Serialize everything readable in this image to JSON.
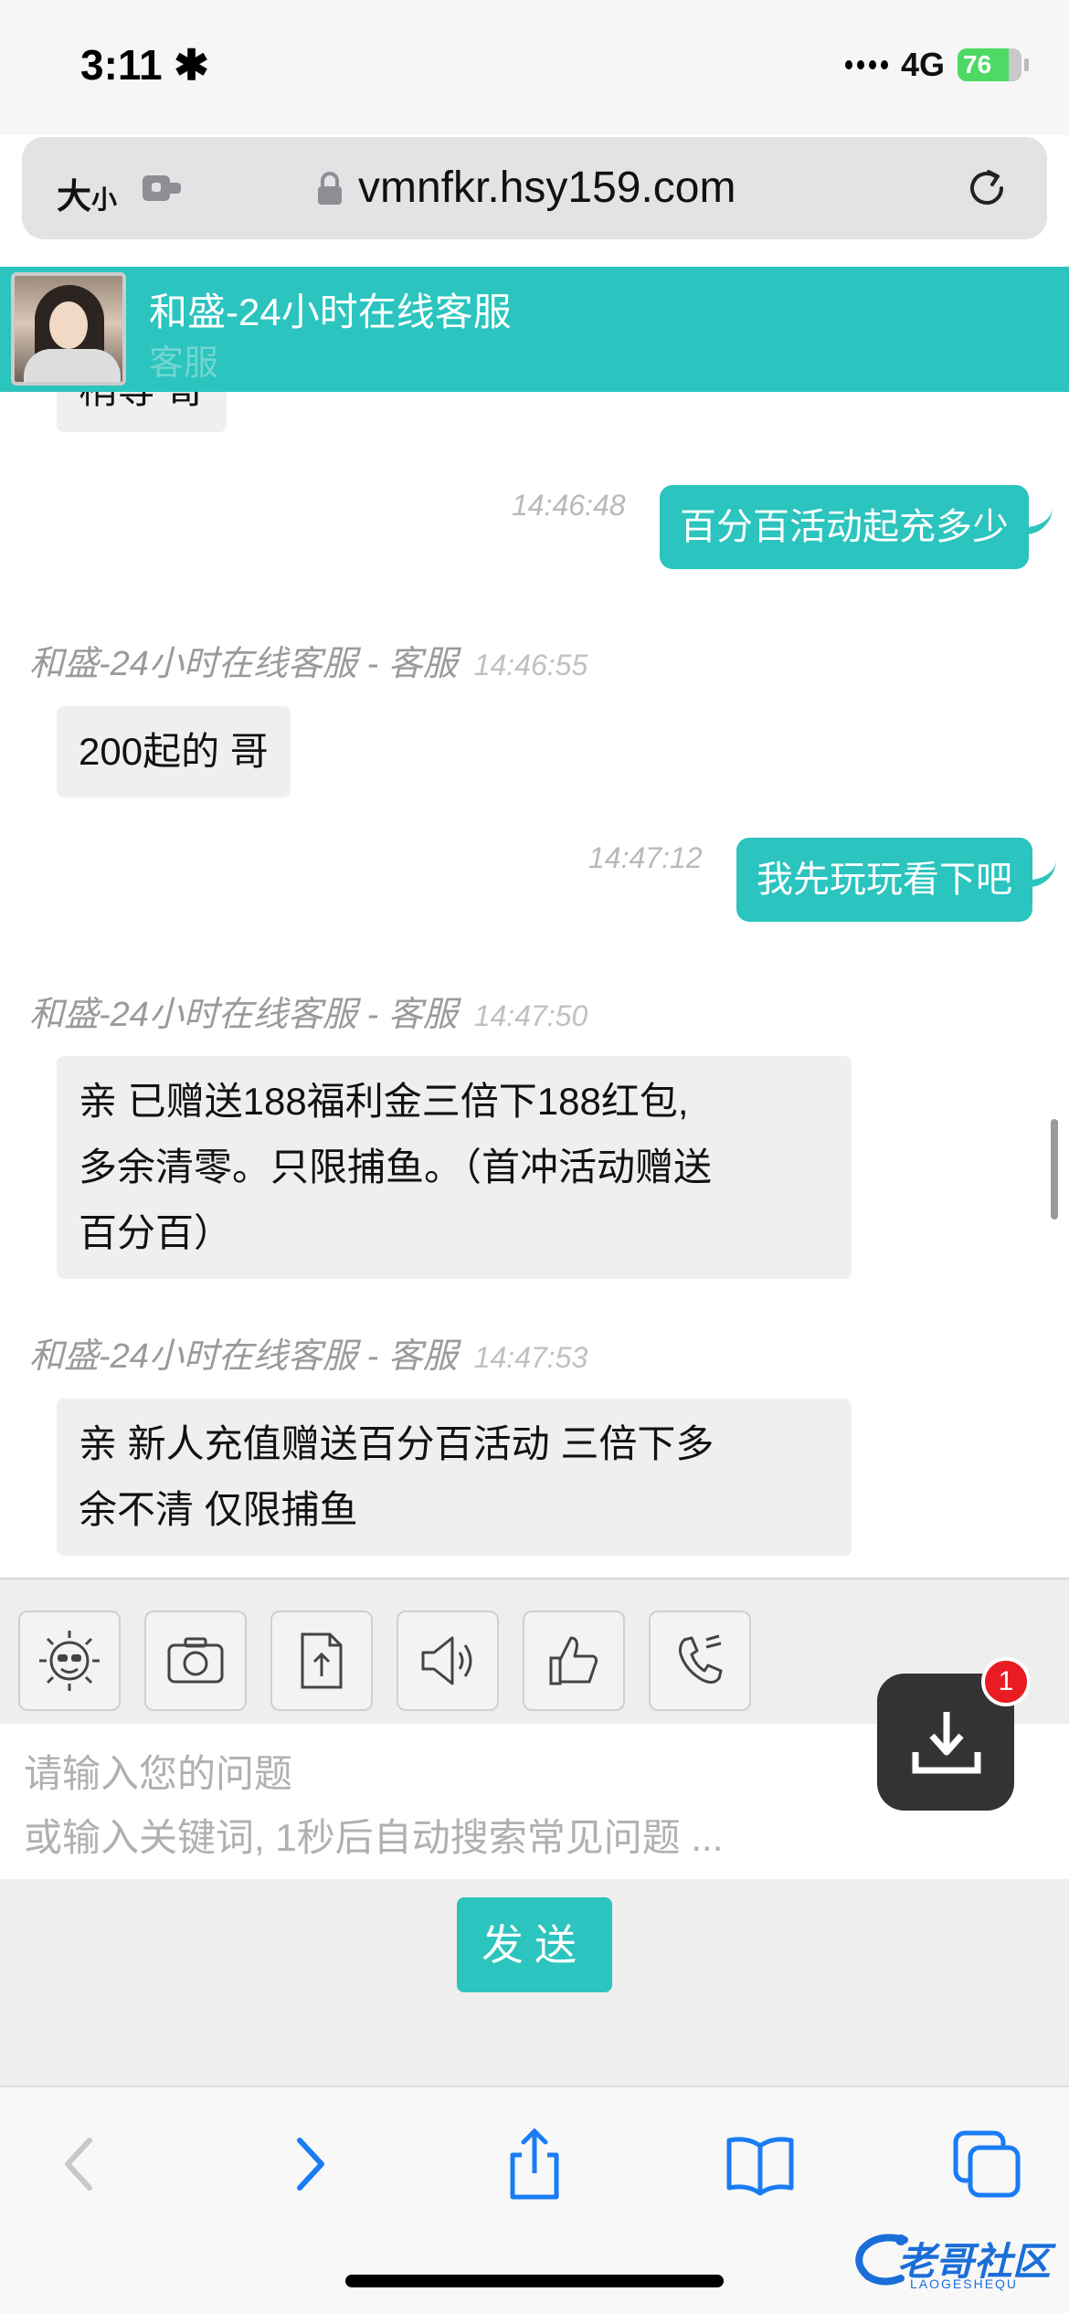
{
  "status_bar": {
    "time": "3:11",
    "network": "4G",
    "battery": "76"
  },
  "url_bar": {
    "text_size": "大",
    "text_size_small": "小",
    "url": "vmnfkr.hsy159.com"
  },
  "chat_header": {
    "title": "和盛-24小时在线客服",
    "subtitle": "客服"
  },
  "messages": [
    {
      "side": "left",
      "text": "稍等 哥"
    },
    {
      "side": "right",
      "time": "14:46:48",
      "text": "百分百活动起充多少"
    },
    {
      "side": "left",
      "sender": "和盛-24小时在线客服 - 客服",
      "time": "14:46:55",
      "text": "200起的 哥"
    },
    {
      "side": "right",
      "time": "14:47:12",
      "text": "我先玩玩看下吧"
    },
    {
      "side": "left",
      "sender": "和盛-24小时在线客服 - 客服",
      "time": "14:47:50",
      "lines": [
        "亲 已赠送188福利金三倍下188红包,",
        "多余清零。只限捕鱼。（首冲活动赠送",
        "百分百）"
      ]
    },
    {
      "side": "left",
      "sender": "和盛-24小时在线客服 - 客服",
      "time": "14:47:53",
      "lines": [
        "亲 新人充值赠送百分百活动 三倍下多",
        "余不清 仅限捕鱼"
      ]
    }
  ],
  "toolbar": {
    "icons": [
      "emoji-icon",
      "camera-icon",
      "upload-file-icon",
      "speaker-icon",
      "thumbs-up-icon",
      "phone-icon"
    ]
  },
  "input": {
    "placeholder": "请输入您的问题\n或输入关键词, 1秒后自动搜索常见问题 ..."
  },
  "download": {
    "badge": "1"
  },
  "send": {
    "label": "发送"
  },
  "watermark": {
    "text": "老哥社区",
    "sub": "LAOGESHEQU"
  },
  "colors": {
    "accent": "#2bc4be",
    "badge": "#e91c24",
    "bubble_left": "#efefef"
  }
}
